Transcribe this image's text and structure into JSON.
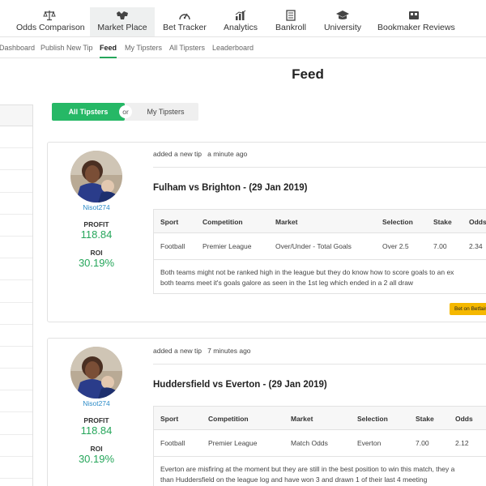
{
  "nav": {
    "items": [
      {
        "label": "Odds Comparison",
        "icon": "scales-icon"
      },
      {
        "label": "Market Place",
        "icon": "cattle-icon"
      },
      {
        "label": "Bet Tracker",
        "icon": "speedometer-icon"
      },
      {
        "label": "Analytics",
        "icon": "bar-chart-icon"
      },
      {
        "label": "Bankroll",
        "icon": "ledger-icon"
      },
      {
        "label": "University",
        "icon": "graduation-cap-icon"
      },
      {
        "label": "Bookmaker Reviews",
        "icon": "card-icon"
      }
    ],
    "active": "Market Place"
  },
  "subnav": {
    "items": [
      "Dashboard",
      "Publish New Tip",
      "Feed",
      "My Tipsters",
      "All Tipsters",
      "Leaderboard"
    ],
    "active": "Feed"
  },
  "page": {
    "title": "Feed"
  },
  "toggle": {
    "all": "All Tipsters",
    "or": "or",
    "mine": "My Tipsters"
  },
  "table_headers": {
    "sport": "Sport",
    "competition": "Competition",
    "market": "Market",
    "selection": "Selection",
    "stake": "Stake",
    "odds": "Odds"
  },
  "tips": [
    {
      "user": "Nisot274",
      "profit_label": "PROFIT",
      "profit": "118.84",
      "roi_label": "ROI",
      "roi": "30.19%",
      "added": "added a new tip",
      "time": "a minute ago",
      "match": "Fulham vs Brighton - (29 Jan 2019)",
      "sport": "Football",
      "competition": "Premier League",
      "market": "Over/Under - Total Goals",
      "selection": "Over 2.5",
      "stake": "7.00",
      "odds": "2.34",
      "description_line1": "Both teams might not be ranked high in the league but they do know how to score goals to an ex",
      "description_line2": "both teams meet it's goals galore as seen in the 1st leg which ended in a 2 all draw",
      "button": "Bet on Betfair"
    },
    {
      "user": "Nisot274",
      "profit_label": "PROFIT",
      "profit": "118.84",
      "roi_label": "ROI",
      "roi": "30.19%",
      "added": "added a new tip",
      "time": "7 minutes ago",
      "match": "Huddersfield vs Everton - (29 Jan 2019)",
      "sport": "Football",
      "competition": "Premier League",
      "market": "Match Odds",
      "selection": "Everton",
      "stake": "7.00",
      "odds": "2.12",
      "description_line1": "Everton are misfiring at the moment but they are still in the best position to win this match, they a",
      "description_line2": "than Huddersfield on the league log and have won 3 and drawn 1 of their last 4 meeting"
    }
  ],
  "colors": {
    "accent": "#26b866",
    "profit": "#26a65b",
    "button": "#f5b800",
    "username": "#2c8bc7"
  }
}
